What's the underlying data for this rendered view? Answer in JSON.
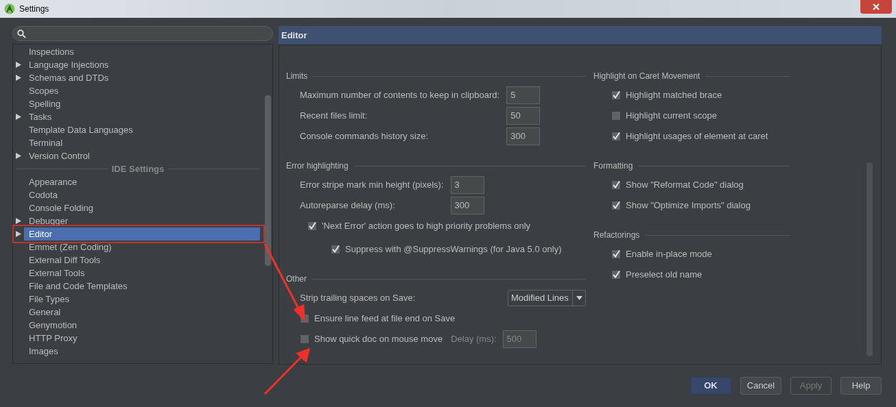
{
  "window": {
    "title": "Settings"
  },
  "tree": [
    {
      "kind": "item",
      "label": "Inspections",
      "expandable": false,
      "selected": false
    },
    {
      "kind": "item",
      "label": "Language Injections",
      "expandable": true,
      "selected": false
    },
    {
      "kind": "item",
      "label": "Schemas and DTDs",
      "expandable": true,
      "selected": false
    },
    {
      "kind": "item",
      "label": "Scopes",
      "expandable": false,
      "selected": false
    },
    {
      "kind": "item",
      "label": "Spelling",
      "expandable": false,
      "selected": false
    },
    {
      "kind": "item",
      "label": "Tasks",
      "expandable": true,
      "selected": false
    },
    {
      "kind": "item",
      "label": "Template Data Languages",
      "expandable": false,
      "selected": false
    },
    {
      "kind": "item",
      "label": "Terminal",
      "expandable": false,
      "selected": false
    },
    {
      "kind": "item",
      "label": "Version Control",
      "expandable": true,
      "selected": false
    },
    {
      "kind": "group",
      "label": "IDE Settings"
    },
    {
      "kind": "item",
      "label": "Appearance",
      "expandable": false,
      "selected": false
    },
    {
      "kind": "item",
      "label": "Codota",
      "expandable": false,
      "selected": false
    },
    {
      "kind": "item",
      "label": "Console Folding",
      "expandable": false,
      "selected": false
    },
    {
      "kind": "item",
      "label": "Debugger",
      "expandable": true,
      "selected": false
    },
    {
      "kind": "item",
      "label": "Editor",
      "expandable": true,
      "selected": true
    },
    {
      "kind": "item",
      "label": "Emmet (Zen Coding)",
      "expandable": false,
      "selected": false
    },
    {
      "kind": "item",
      "label": "External Diff Tools",
      "expandable": false,
      "selected": false
    },
    {
      "kind": "item",
      "label": "External Tools",
      "expandable": false,
      "selected": false
    },
    {
      "kind": "item",
      "label": "File and Code Templates",
      "expandable": false,
      "selected": false
    },
    {
      "kind": "item",
      "label": "File Types",
      "expandable": false,
      "selected": false
    },
    {
      "kind": "item",
      "label": "General",
      "expandable": false,
      "selected": false
    },
    {
      "kind": "item",
      "label": "Genymotion",
      "expandable": false,
      "selected": false
    },
    {
      "kind": "item",
      "label": "HTTP Proxy",
      "expandable": false,
      "selected": false
    },
    {
      "kind": "item",
      "label": "Images",
      "expandable": false,
      "selected": false
    }
  ],
  "panel": {
    "title": "Editor",
    "columns": [
      [
        {
          "title": "Limits",
          "rows": [
            {
              "kind": "number",
              "label": "Maximum number of contents to keep in clipboard:",
              "value": "5"
            },
            {
              "kind": "number",
              "label": "Recent files limit:",
              "value": "50"
            },
            {
              "kind": "number",
              "label": "Console commands history size:",
              "value": "300"
            }
          ]
        },
        {
          "title": "Error highlighting",
          "rows": [
            {
              "kind": "number",
              "label": "Error stripe mark min height (pixels):",
              "value": "3"
            },
            {
              "kind": "number",
              "label": "Autoreparse delay (ms):",
              "value": "300"
            },
            {
              "kind": "checkbox",
              "label": "'Next Error' action goes to high priority problems only",
              "checked": true,
              "children": [
                {
                  "kind": "checkbox",
                  "label": "Suppress with @SuppressWarnings (for Java 5.0 only)",
                  "checked": true
                }
              ]
            }
          ]
        },
        {
          "title": "Other",
          "rows": [
            {
              "kind": "dropdown",
              "label": "Strip trailing spaces on Save:",
              "value": "Modified Lines"
            },
            {
              "kind": "checkbox",
              "label": "Ensure line feed at file end on Save",
              "checked": false
            },
            {
              "kind": "checkbox_field",
              "label": "Show quick doc on mouse move",
              "checked": false,
              "field_label": "Delay (ms):",
              "value": "500"
            }
          ]
        }
      ],
      [
        {
          "title": "Highlight on Caret Movement",
          "rows": [
            {
              "kind": "checkbox",
              "label": "Highlight matched brace",
              "checked": true
            },
            {
              "kind": "checkbox",
              "label": "Highlight current scope",
              "checked": false
            },
            {
              "kind": "checkbox",
              "label": "Highlight usages of element at caret",
              "checked": true
            }
          ]
        },
        {
          "title": "Formatting",
          "rows": [
            {
              "kind": "checkbox",
              "label": "Show \"Reformat Code\" dialog",
              "checked": true
            },
            {
              "kind": "checkbox",
              "label": "Show \"Optimize Imports\" dialog",
              "checked": true
            }
          ]
        },
        {
          "title": "Refactorings",
          "rows": [
            {
              "kind": "checkbox",
              "label": "Enable in-place mode",
              "checked": true
            },
            {
              "kind": "checkbox",
              "label": "Preselect old name",
              "checked": true
            }
          ]
        }
      ]
    ]
  },
  "buttons": [
    {
      "label": "OK",
      "kind": "default",
      "disabled": false
    },
    {
      "label": "Cancel",
      "kind": "normal",
      "disabled": false
    },
    {
      "label": "Apply",
      "kind": "normal",
      "disabled": true
    },
    {
      "label": "Help",
      "kind": "normal",
      "disabled": false
    }
  ]
}
